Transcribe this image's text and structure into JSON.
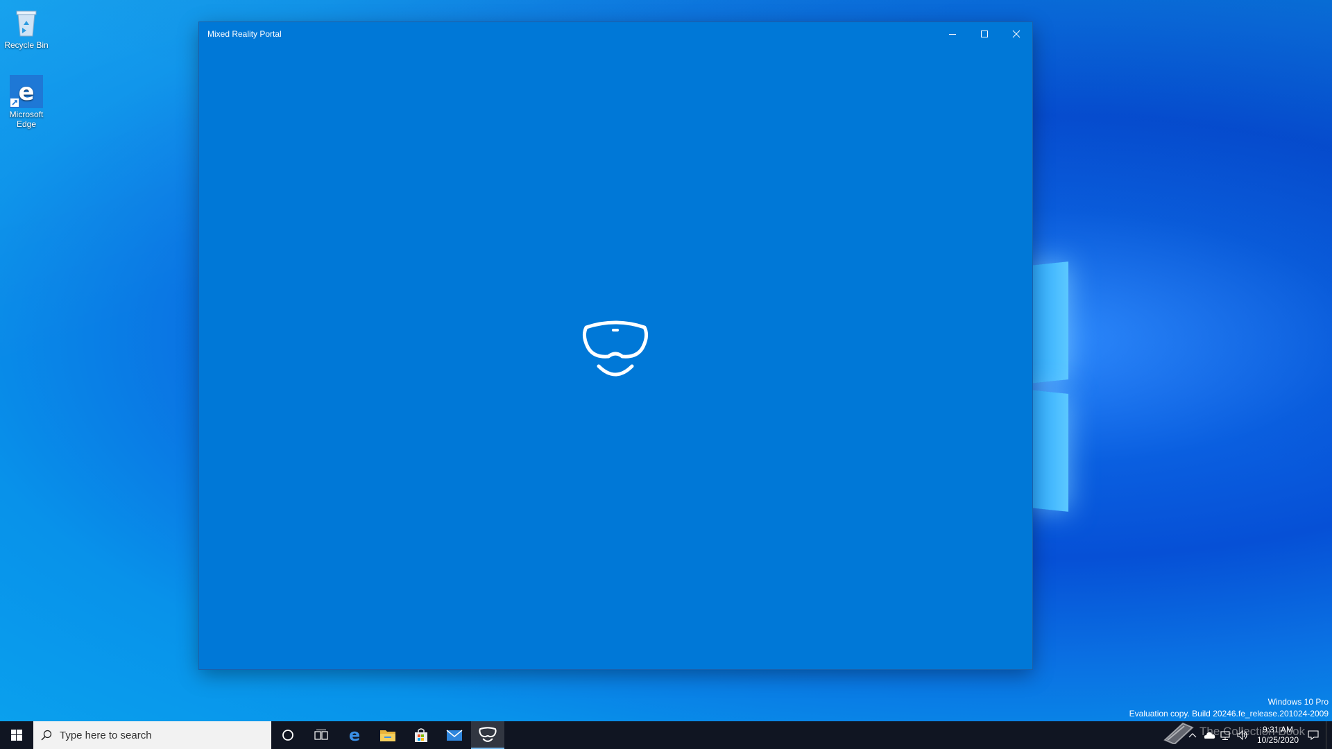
{
  "desktop": {
    "icons": [
      {
        "label": "Recycle Bin",
        "icon": "recycle-bin-icon"
      },
      {
        "label": "Microsoft Edge",
        "icon": "edge-icon"
      }
    ]
  },
  "window": {
    "title": "Mixed Reality Portal",
    "splash_icon": "mixed-reality-headset-icon",
    "background": "#0078d7"
  },
  "watermark": {
    "edition": "Windows 10 Pro",
    "build": "Evaluation copy. Build 20246.fe_release.201024-2009"
  },
  "taskbar": {
    "search_placeholder": "Type here to search",
    "apps": [
      {
        "name": "cortana",
        "icon": "cortana-circle-icon"
      },
      {
        "name": "task-view",
        "icon": "task-view-icon"
      },
      {
        "name": "edge",
        "icon": "edge-icon"
      },
      {
        "name": "file-explorer",
        "icon": "folder-icon"
      },
      {
        "name": "store",
        "icon": "store-bag-icon"
      },
      {
        "name": "mail",
        "icon": "mail-icon"
      },
      {
        "name": "mixed-reality-portal",
        "icon": "mixed-reality-headset-icon",
        "active": true
      }
    ],
    "tray": {
      "time": "9:31 AM",
      "date": "10/25/2020"
    }
  },
  "overlay_text": "The Collection Book"
}
